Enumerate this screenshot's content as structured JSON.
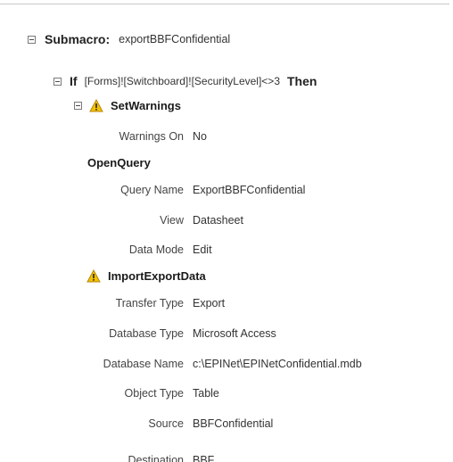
{
  "submacro": {
    "keyword": "Submacro:",
    "name": "exportBBFConfidential"
  },
  "if_block": {
    "keyword": "If",
    "condition": "[Forms]![Switchboard]![SecurityLevel]<>3",
    "then_keyword": "Then"
  },
  "actions": [
    {
      "name": "SetWarnings",
      "warning_icon": "warning-icon",
      "arguments": [
        {
          "label": "Warnings On",
          "value": "No"
        }
      ]
    },
    {
      "name": "OpenQuery",
      "arguments": [
        {
          "label": "Query Name",
          "value": "ExportBBFConfidential"
        },
        {
          "label": "View",
          "value": "Datasheet"
        },
        {
          "label": "Data Mode",
          "value": "Edit"
        }
      ]
    },
    {
      "name": "ImportExportData",
      "warning_icon": "warning-icon",
      "arguments": [
        {
          "label": "Transfer Type",
          "value": "Export"
        },
        {
          "label": "Database Type",
          "value": "Microsoft Access"
        },
        {
          "label": "Database Name",
          "value": "c:\\EPINet\\EPINetConfidential.mdb"
        },
        {
          "label": "Object Type",
          "value": "Table"
        },
        {
          "label": "Source",
          "value": "BBFConfidential"
        },
        {
          "label": "Destination",
          "value": "BBF"
        }
      ]
    }
  ],
  "colors": {
    "warning_fill": "#f2c200",
    "warning_stroke": "#b8860b",
    "text": "#333333"
  }
}
